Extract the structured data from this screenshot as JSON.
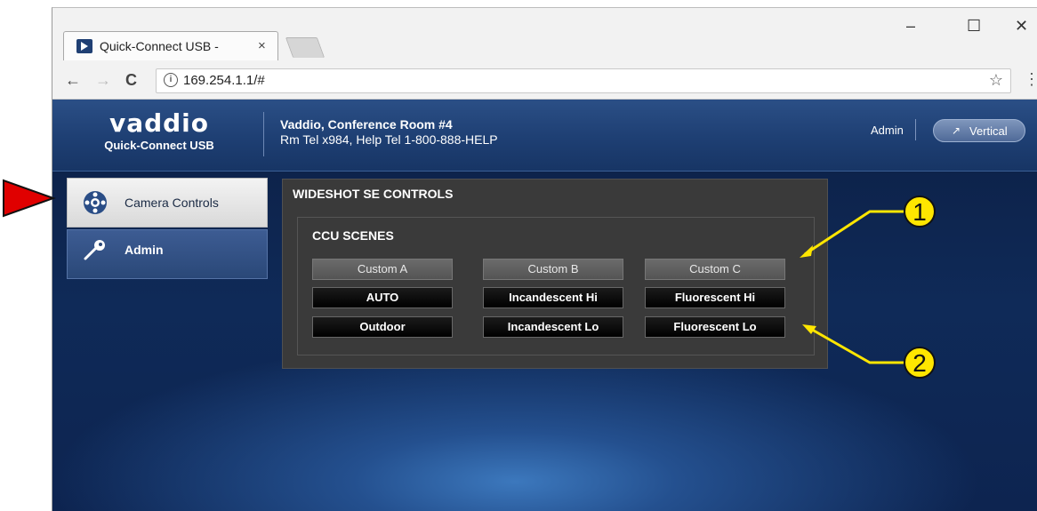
{
  "browser": {
    "tab_title": "Quick-Connect USB -",
    "tab_close": "×",
    "window_minimize": "–",
    "window_maximize": "☐",
    "window_close": "✕",
    "back": "←",
    "forward": "→",
    "reload": "C",
    "url": "169.254.1.1/#",
    "info_icon": "i",
    "bookmark_icon": "☆",
    "menu_icon": "⋮"
  },
  "header": {
    "logo_text": "vaddio",
    "logo_sub": "Quick-Connect USB",
    "room_title": "Vaddio, Conference Room #4",
    "room_sub": "Rm Tel x984, Help Tel 1-800-888-HELP",
    "user": "Admin",
    "vertical_label": "Vertical",
    "vertical_icon": "↗"
  },
  "sidebar": {
    "items": [
      {
        "label": "Camera Controls",
        "icon": "camera-controls-icon"
      },
      {
        "label": "Admin",
        "icon": "key-icon"
      }
    ]
  },
  "panel": {
    "title": "WIDESHOT SE CONTROLS",
    "group_title": "CCU SCENES",
    "custom_buttons": [
      "Custom A",
      "Custom B",
      "Custom C"
    ],
    "scene_row1": [
      "AUTO",
      "Incandescent Hi",
      "Fluorescent Hi"
    ],
    "scene_row2": [
      "Outdoor",
      "Incandescent Lo",
      "Fluorescent Lo"
    ]
  },
  "annotations": {
    "callout1": "1",
    "callout2": "2",
    "pointer_color": "#e00000",
    "callout_color": "#ffe600",
    "leader_color": "#ffe600"
  }
}
